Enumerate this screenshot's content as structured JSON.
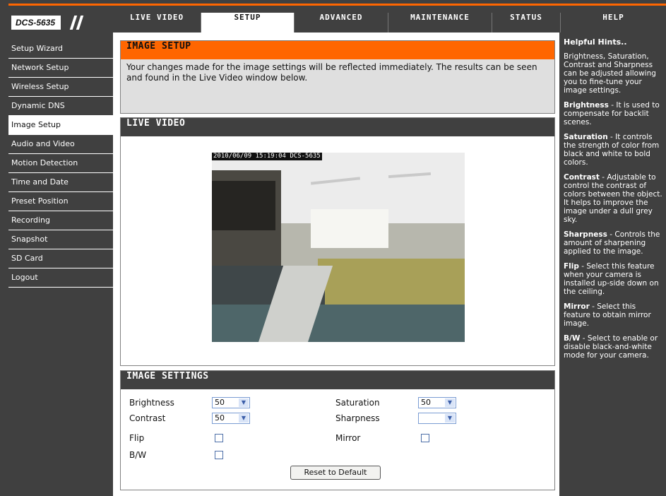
{
  "logo": {
    "text": "DCS-5635"
  },
  "nav": {
    "tabs": [
      "LIVE VIDEO",
      "SETUP",
      "ADVANCED",
      "MAINTENANCE",
      "STATUS",
      "HELP"
    ],
    "active": "SETUP"
  },
  "sidebar": {
    "items": [
      "Setup Wizard",
      "Network Setup",
      "Wireless Setup",
      "Dynamic DNS",
      "Image Setup",
      "Audio and Video",
      "Motion Detection",
      "Time and Date",
      "Preset Position",
      "Recording",
      "Snapshot",
      "SD Card",
      "Logout"
    ],
    "active": "Image Setup"
  },
  "image_setup": {
    "title": "IMAGE SETUP",
    "description": "Your changes made for the image settings will be reflected immediately. The results can be seen and found in the Live Video window below."
  },
  "live_video": {
    "title": "LIVE VIDEO",
    "timestamp": "2010/06/09 15:19:04 DCS-5635"
  },
  "image_settings": {
    "title": "IMAGE SETTINGS",
    "brightness": {
      "label": "Brightness",
      "value": "50"
    },
    "saturation": {
      "label": "Saturation",
      "value": "50"
    },
    "contrast": {
      "label": "Contrast",
      "value": "50"
    },
    "sharpness": {
      "label": "Sharpness",
      "value": ""
    },
    "flip": {
      "label": "Flip",
      "checked": false
    },
    "mirror": {
      "label": "Mirror",
      "checked": false
    },
    "bw": {
      "label": "B/W",
      "checked": false
    },
    "reset_label": "Reset to Default"
  },
  "hints": {
    "title": "Helpful Hints..",
    "intro": "Brightness, Saturation, Contrast and Sharpness can be adjusted allowing you to fine-tune your image settings.",
    "items": [
      {
        "term": "Brightness",
        "text": " - It is used to compensate for backlit scenes."
      },
      {
        "term": "Saturation",
        "text": " - It controls the strength of color from black and white to bold colors."
      },
      {
        "term": "Contrast",
        "text": " - Adjustable to control the contrast of colors between the object. It helps to improve the image under a dull grey sky."
      },
      {
        "term": "Sharpness",
        "text": " - Controls the amount of sharpening applied to the image."
      },
      {
        "term": "Flip",
        "text": " - Select this feature when your camera is installed up-side down on the ceiling."
      },
      {
        "term": "Mirror",
        "text": " - Select this feature to obtain mirror image."
      },
      {
        "term": "B/W",
        "text": " - Select to enable or disable black-and-white mode for your camera."
      }
    ]
  },
  "colors": {
    "accent": "#ff6600",
    "chrome": "#404040"
  }
}
